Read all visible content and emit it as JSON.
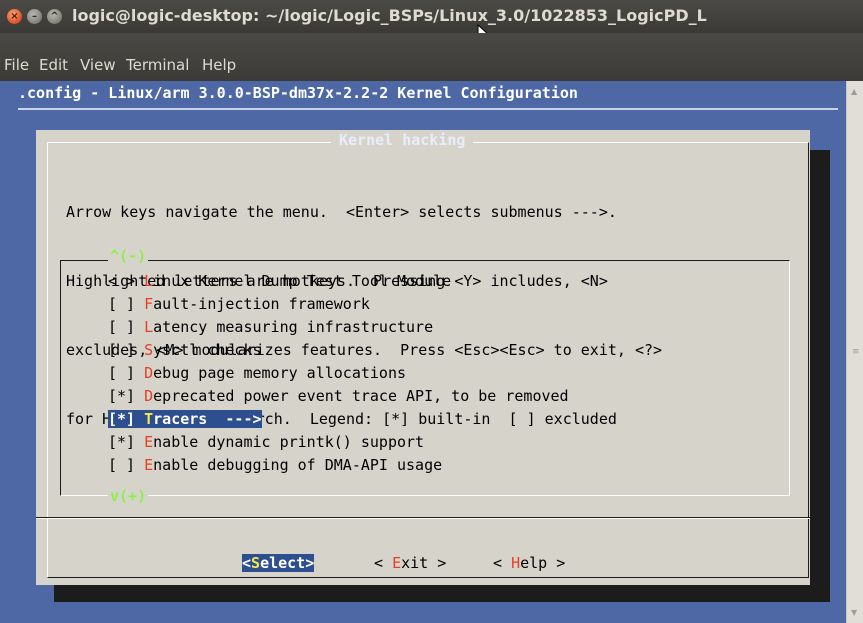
{
  "window": {
    "title": "logic@logic-desktop: ~/logic/Logic_BSPs/Linux_3.0/1022853_LogicPD_L",
    "close_glyph": "×",
    "min_glyph": "–",
    "max_glyph": "^"
  },
  "menubar": {
    "items": [
      "File",
      "Edit",
      "View",
      "Terminal",
      "Help"
    ]
  },
  "terminal": {
    "config_title": ".config - Linux/arm 3.0.0-BSP-dm37x-2.2-2 Kernel Configuration"
  },
  "dialog": {
    "title": "Kernel hacking",
    "help_lines": [
      "Arrow keys navigate the menu.  <Enter> selects submenus --->.",
      "Highlighted letters are hotkeys.  Pressing <Y> includes, <N>",
      "excludes, <M> modularizes features.  Press <Esc><Esc> to exit, <?>",
      "for Help, </> for Search.  Legend: [*] built-in  [ ] excluded"
    ],
    "scroll_up": "^(-)",
    "scroll_down": "v(+)",
    "items": [
      {
        "prefix": "< > ",
        "hotkey": "L",
        "rest": "inux Kernel Dump Test Tool Module"
      },
      {
        "prefix": "[ ] ",
        "hotkey": "F",
        "rest": "ault-injection framework"
      },
      {
        "prefix": "[ ] ",
        "hotkey": "L",
        "rest": "atency measuring infrastructure"
      },
      {
        "prefix": "[ ] ",
        "hotkey": "S",
        "rest": "ysctl checks"
      },
      {
        "prefix": "[ ] ",
        "hotkey": "D",
        "rest": "ebug page memory allocations"
      },
      {
        "prefix": "[*] ",
        "hotkey": "D",
        "rest": "eprecated power event trace API, to be removed"
      },
      {
        "prefix": "[*] ",
        "hotkey": "T",
        "rest": "racers  --->"
      },
      {
        "prefix": "[*] ",
        "hotkey": "E",
        "rest": "nable dynamic printk() support"
      },
      {
        "prefix": "[ ] ",
        "hotkey": "E",
        "rest": "nable debugging of DMA-API usage"
      }
    ],
    "buttons": {
      "select": {
        "open": "<",
        "hotkey": "S",
        "rest": "elect>"
      },
      "exit": {
        "open": "< ",
        "hotkey": "E",
        "rest": "xit >"
      },
      "help": {
        "open": "< ",
        "hotkey": "H",
        "rest": "elp >"
      }
    }
  },
  "colors": {
    "terminal_bg": "#4d68a4",
    "dialog_bg": "#d6d3cb",
    "selection_bg": "#2d4e8f",
    "hotkey": "#e93d24",
    "selected_hotkey": "#f8e84b",
    "scroll_indicator": "#8ff04a"
  }
}
